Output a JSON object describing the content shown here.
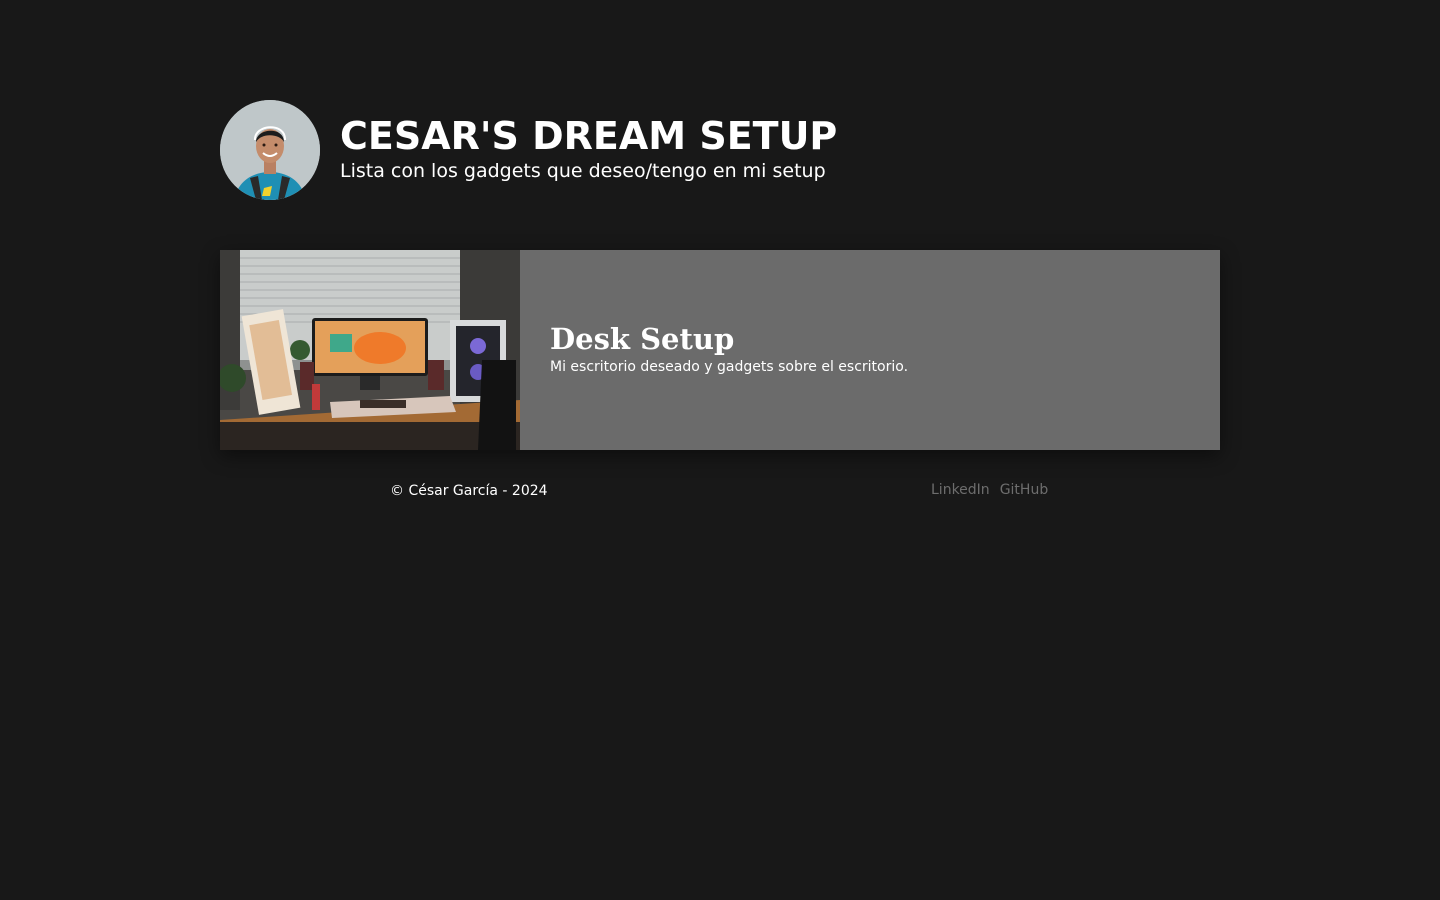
{
  "header": {
    "title": "CESAR'S DREAM SETUP",
    "subtitle": "Lista con los gadgets que deseo/tengo en mi setup",
    "avatar_icon": "profile-photo"
  },
  "cards": [
    {
      "title": "Desk Setup",
      "description": "Mi escritorio deseado y gadgets sobre el escritorio.",
      "image_icon": "desk-setup-photo"
    }
  ],
  "footer": {
    "copyright": "© César García - 2024",
    "links": [
      {
        "label": "LinkedIn"
      },
      {
        "label": "GitHub"
      }
    ]
  },
  "colors": {
    "background": "#181818",
    "card_background": "#6b6b6b",
    "link": "#6d6d6d",
    "text": "#ffffff"
  }
}
